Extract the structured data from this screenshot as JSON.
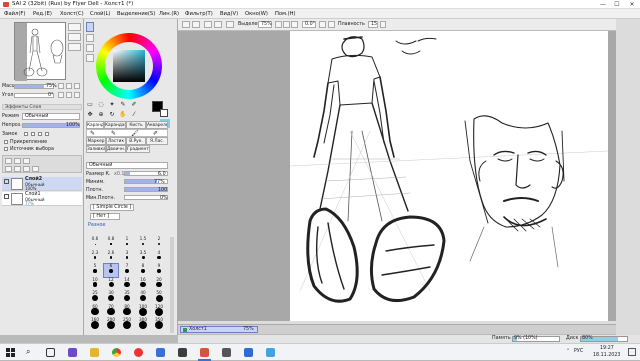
{
  "window": {
    "title": "SAI 2 (32bit) (Rus) by Flyer Dell - Холст1 (*)",
    "minimize": "—",
    "maximize": "☐",
    "close": "✕"
  },
  "menu": [
    "Файл(F)",
    "Ред.(E)",
    "Холст(C)",
    "Слой(L)",
    "Выделение(S)",
    "Лин.(R)",
    "Фильтр(T)",
    "Вид(V)",
    "Окно(W)",
    "Пом.(H)"
  ],
  "nav": {
    "zoom_label": "Масш.",
    "zoom_value": "75%",
    "angle_label": "Угол",
    "angle_value": "0°",
    "zoom_fraction": 0.75
  },
  "layer_effects": {
    "header": "Эффекты Слоя",
    "mode_label": "Режим",
    "mode_value": "Обычный",
    "opacity_label": "Непроз.",
    "opacity_value": "100%",
    "lock_label": "Замок",
    "clip_label": "Прикрепление",
    "source_label": "Источник выбора"
  },
  "layers": [
    {
      "name": "Слой2",
      "mode": "Обычный",
      "opacity": "100%",
      "selected": true
    },
    {
      "name": "Слой1",
      "mode": "Обычный",
      "opacity": "77%",
      "selected": false
    }
  ],
  "color": {
    "primary": "#000000",
    "secondary": "#ffffff",
    "selection_color": "#7ed2e6"
  },
  "tool_tabs_row1": [
    "Каранд.",
    "Карандаш",
    "Кисть",
    "Акварель"
  ],
  "tool_tabs_row2": [
    "Маркер",
    "Ластик",
    "В.Рук.",
    "Я.Лас."
  ],
  "tool_tabs_row3": [
    "Заливка",
    "Двоичн.",
    "Градиент"
  ],
  "brush": {
    "mode": "Обычный",
    "size_label": "Размер К.",
    "size_mult": "x0.1",
    "size_value": "6.0",
    "min_label": "Миним.",
    "min_value": "77%",
    "min_fraction": 0.77,
    "density_label": "Плотн.",
    "density_value": "100",
    "density_fraction": 1.0,
    "max_label": "Мин.Плотн.",
    "max_value": "0%",
    "max_fraction": 0.0,
    "shape": "[ Simple Circle ]",
    "texture": "[ Нет ]",
    "misc_header": "Разное"
  },
  "brush_sizes": [
    [
      "0.6",
      "0.8",
      "1",
      "1.5",
      "2"
    ],
    [
      "2.3",
      "2.6",
      "3",
      "3.5",
      "4"
    ],
    [
      "5",
      "6",
      "7",
      "8",
      "9"
    ],
    [
      "10",
      "12",
      "14",
      "16",
      "20"
    ],
    [
      "25",
      "30",
      "35",
      "40",
      "50"
    ],
    [
      "60",
      "70",
      "80",
      "100",
      "120"
    ],
    [
      "160",
      "200",
      "250",
      "300",
      "350"
    ]
  ],
  "brush_selected_index": 11,
  "toolbar": {
    "selection_label": "Выделение",
    "selection_value": "75%",
    "angle_value": "0.0°",
    "smooth_label": "Плавность",
    "smooth_value": "15"
  },
  "canvas_tab": {
    "name": "Холст1",
    "zoom": "75%"
  },
  "status": {
    "memory_label": "Память",
    "memory_value": "9% (10%)",
    "memory_fraction": 0.09,
    "disk_label": "Диск",
    "disk_value": "80%",
    "disk_fraction": 0.8
  },
  "taskbar": {
    "lang": "РУС",
    "time": "19:27",
    "date": "18.11.2023"
  },
  "icons": [
    "windows-icon",
    "search-icon",
    "task-view-icon",
    "explorer-icon",
    "chrome-icon",
    "yandex-icon",
    "store-icon",
    "sai-icon"
  ]
}
